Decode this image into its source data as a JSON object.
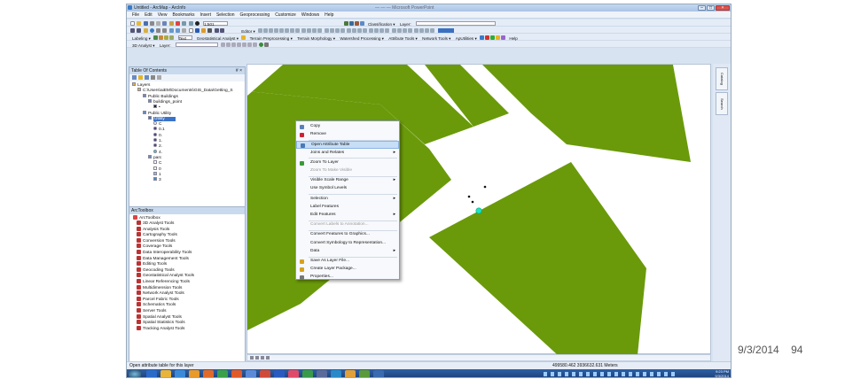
{
  "window": {
    "title": "Untitled - ArcMap - ArcInfo",
    "blurred_title": "— — — Microsoft PowerPoint"
  },
  "menu": [
    "File",
    "Edit",
    "View",
    "Bookmarks",
    "Insert",
    "Selection",
    "Geoprocessing",
    "Customize",
    "Windows",
    "Help"
  ],
  "toolbar1": {
    "scale": "1:501",
    "classification": "Classification ▾",
    "layer": "Layer:"
  },
  "toolbar2": {
    "editor": "Editor ▾"
  },
  "toolbar3": {
    "labeling": "Labeling ▾",
    "font": "Text",
    "geostat": "Geostatistical Analyst ▾",
    "terrain": "Terrain Preprocessing ▾",
    "morph": "Terrain Morphology ▾",
    "water": "Watershed Processing ▾",
    "attr": "Attribute Tools ▾",
    "net": "Network Tools ▾",
    "aputil": "ApUtilities ▾",
    "help": "Help"
  },
  "toolbar4": {
    "analyst": "3D Analyst ▾",
    "layer": "Layer:"
  },
  "toc": {
    "title": "Table Of Contents",
    "pin": "# ×",
    "items": [
      {
        "label": "Layers",
        "indent": 0
      },
      {
        "label": "C:\\Users\\aiEM\\Documents\\GIS_Data\\Getting_S",
        "indent": 1
      },
      {
        "label": "Public Buildings",
        "indent": 2
      },
      {
        "label": "buildings_point",
        "indent": 3
      },
      {
        "label": "•",
        "indent": 4
      },
      {
        "label": "Public Utility",
        "indent": 2
      },
      {
        "label": "Utility",
        "indent": 3
      },
      {
        "label": "C",
        "indent": 4
      },
      {
        "label": "0.1",
        "indent": 4
      },
      {
        "label": "0.",
        "indent": 4
      },
      {
        "label": "1.",
        "indent": 4
      },
      {
        "label": "2.",
        "indent": 4
      },
      {
        "label": "4.",
        "indent": 4
      },
      {
        "label": "parc",
        "indent": 3
      },
      {
        "label": "C",
        "indent": 4
      },
      {
        "label": "0",
        "indent": 4
      },
      {
        "label": "1",
        "indent": 4
      },
      {
        "label": "3",
        "indent": 4
      }
    ]
  },
  "toolbox": {
    "title": "ArcToolbox",
    "root": "ArcToolbox",
    "tools": [
      "3D Analyst Tools",
      "Analysis Tools",
      "Cartography Tools",
      "Conversion Tools",
      "Coverage Tools",
      "Data Interoperability Tools",
      "Data Management Tools",
      "Editing Tools",
      "Geocoding Tools",
      "Geostatistical Analyst Tools",
      "Linear Referencing Tools",
      "Multidimension Tools",
      "Network Analyst Tools",
      "Parcel Fabric Tools",
      "Schematics Tools",
      "Server Tools",
      "Spatial Analyst Tools",
      "Spatial Statistics Tools",
      "Tracking Analyst Tools"
    ]
  },
  "context_menu": [
    {
      "label": "Copy",
      "state": "normal",
      "icon": "copy-icon",
      "color": "#5b7fb8"
    },
    {
      "label": "Remove",
      "state": "normal",
      "icon": "remove-icon",
      "color": "#c23"
    },
    {
      "label": "Open Attribute Table",
      "state": "highlight",
      "icon": "table-icon",
      "color": "#4a7ab8"
    },
    {
      "label": "Joins and Relates",
      "state": "normal",
      "submenu": true
    },
    {
      "label": "Zoom To Layer",
      "state": "normal",
      "icon": "zoom-layer-icon",
      "color": "#3a9a3a"
    },
    {
      "label": "Zoom To Make Visible",
      "state": "disabled"
    },
    {
      "label": "Visible Scale Range",
      "state": "normal",
      "submenu": true
    },
    {
      "label": "Use Symbol Levels",
      "state": "normal"
    },
    {
      "label": "Selection",
      "state": "normal",
      "submenu": true
    },
    {
      "label": "Label Features",
      "state": "normal"
    },
    {
      "label": "Edit Features",
      "state": "normal",
      "submenu": true
    },
    {
      "label": "Convert Labels to Annotation...",
      "state": "disabled"
    },
    {
      "label": "Convert Features to Graphics...",
      "state": "normal"
    },
    {
      "label": "Convert Symbology to Representation...",
      "state": "normal"
    },
    {
      "label": "Data",
      "state": "normal",
      "submenu": true
    },
    {
      "label": "Save As Layer File...",
      "state": "normal",
      "icon": "save-layer-icon",
      "color": "#d6a21e"
    },
    {
      "label": "Create Layer Package...",
      "state": "normal",
      "icon": "package-icon",
      "color": "#d6a21e"
    },
    {
      "label": "Properties...",
      "state": "normal",
      "icon": "properties-icon",
      "color": "#777"
    }
  ],
  "right_dock": [
    "Catalog",
    "Search"
  ],
  "status": {
    "left": "Open attribute table for this layer",
    "coords": "499580.462 3936632.631 Meters"
  },
  "clock": {
    "time": "9:23 PM",
    "date": "9/3/2014"
  },
  "slide_footer": {
    "date": "9/3/2014",
    "page": "94"
  },
  "colors": {
    "parcel": "#6a9a0a",
    "highlight": "#c7def7",
    "taskbar": "#1d3f78"
  }
}
